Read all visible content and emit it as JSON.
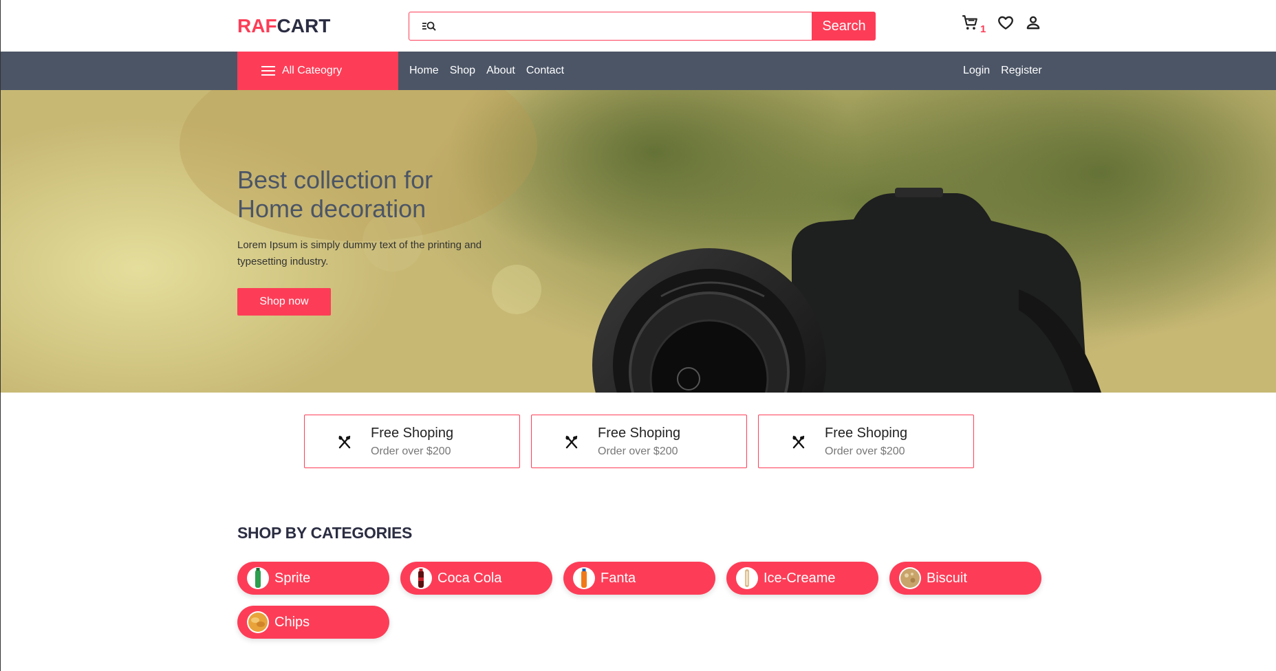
{
  "brand": {
    "part1": "RAF",
    "part2": "CART"
  },
  "search": {
    "placeholder": "",
    "button_label": "Search"
  },
  "header_icons": {
    "cart": "cart-icon",
    "wishlist": "heart-icon",
    "account": "user-icon",
    "cart_count": "1"
  },
  "nav": {
    "all_category_label": "All Cateogry",
    "links": [
      "Home",
      "Shop",
      "About",
      "Contact"
    ],
    "auth": [
      "Login",
      "Register"
    ]
  },
  "hero": {
    "title_line1": "Best collection for",
    "title_line2": "Home decoration",
    "subtitle": "Lorem Ipsum is simply dummy text of the printing and typesetting industry.",
    "cta": "Shop now"
  },
  "features": [
    {
      "icon": "cutlery-icon",
      "title": "Free Shoping",
      "subtitle": "Order over $200"
    },
    {
      "icon": "cutlery-icon",
      "title": "Free Shoping",
      "subtitle": "Order over $200"
    },
    {
      "icon": "cutlery-icon",
      "title": "Free Shoping",
      "subtitle": "Order over $200"
    }
  ],
  "categories": {
    "heading": "SHOP BY CATEGORIES",
    "items": [
      {
        "label": "Sprite",
        "thumb_color": "#2e9e4f"
      },
      {
        "label": "Coca Cola",
        "thumb_color": "#8b1a1a"
      },
      {
        "label": "Fanta",
        "thumb_color": "#f07a1a"
      },
      {
        "label": "Ice-Creame",
        "thumb_color": "#d9b98a"
      },
      {
        "label": "Biscuit",
        "thumb_color": "#c9a46a"
      },
      {
        "label": "Chips",
        "thumb_color": "#e8a33a"
      }
    ]
  },
  "colors": {
    "accent": "#fd3d57",
    "nav_bg": "#4b5566",
    "heading": "#2b2d42"
  }
}
